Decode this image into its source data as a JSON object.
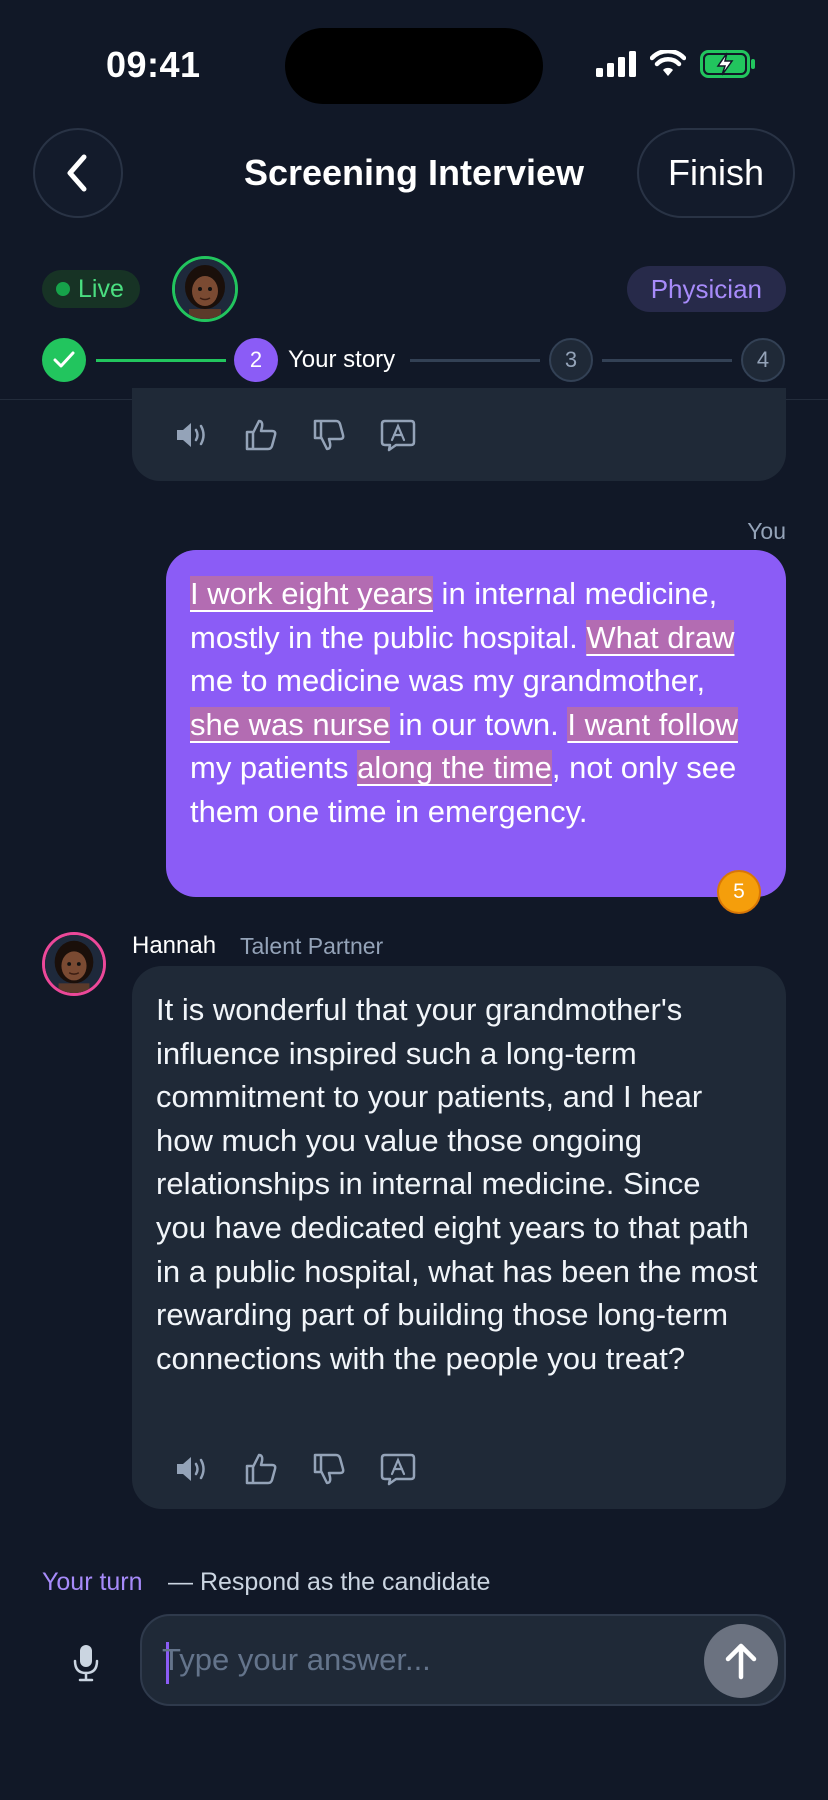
{
  "status_bar": {
    "time": "09:41"
  },
  "header": {
    "title": "Screening Interview",
    "finish_label": "Finish"
  },
  "session": {
    "live_label": "Live",
    "role_label": "Physician"
  },
  "stepper": {
    "steps": [
      {
        "state": "done",
        "icon": "check-icon"
      },
      {
        "number": "2",
        "label": "Your story",
        "state": "active"
      },
      {
        "number": "3",
        "state": "upcoming"
      },
      {
        "number": "4",
        "state": "upcoming"
      }
    ]
  },
  "messages": [
    {
      "sender": "You",
      "segments": [
        {
          "text": "I work eight years",
          "error": true
        },
        {
          "text": " in internal medicine, mostly in the public hospital. "
        },
        {
          "text": "What draw",
          "error": true
        },
        {
          "text": " me to medicine was my grandmother, "
        },
        {
          "text": "she was nurse",
          "error": true
        },
        {
          "text": " in our town. "
        },
        {
          "text": "I want follow",
          "error": true
        },
        {
          "text": " my patients "
        },
        {
          "text": "along the time",
          "error": true
        },
        {
          "text": ", not only see them one time in emergency."
        }
      ],
      "correction_count": "5"
    },
    {
      "sender": "Hannah",
      "sender_role": "Talent Partner",
      "text": "It is wonderful that your grandmother's influence inspired such a long-term commitment to your patients, and I hear how much you value those ongoing relationships in internal medicine. Since you have dedicated eight years to that path in a public hospital, what has been the most rewarding part of building those long-term connections with the people you treat?",
      "actions": [
        "speaker-icon",
        "thumbs-up-icon",
        "thumbs-down-icon",
        "translate-icon"
      ]
    }
  ],
  "composer": {
    "turn_label": "Your turn",
    "turn_subtitle": "— Respond as the candidate",
    "placeholder": "Type your answer..."
  },
  "colors": {
    "background": "#111827",
    "accent": "#8b5cf6",
    "live": "#22c55e",
    "error_highlight": "#d67a7a",
    "badge": "#f59e0b"
  }
}
